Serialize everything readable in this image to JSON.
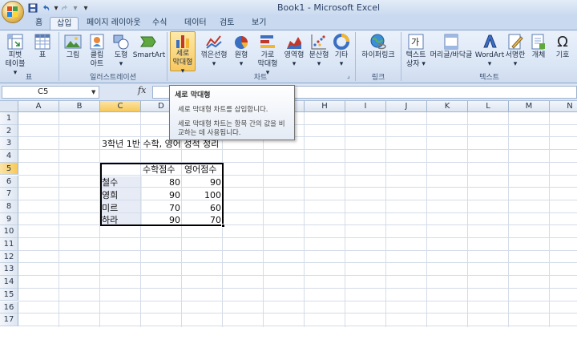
{
  "window": {
    "title": "Book1 - Microsoft Excel"
  },
  "quick_access": {
    "save": "save-icon",
    "undo": "undo-icon",
    "redo": "redo-icon",
    "customize": "▾"
  },
  "tabs": [
    {
      "label": "홈"
    },
    {
      "label": "삽입"
    },
    {
      "label": "페이지 레이아웃"
    },
    {
      "label": "수식"
    },
    {
      "label": "데이터"
    },
    {
      "label": "검토"
    },
    {
      "label": "보기"
    }
  ],
  "ribbon": {
    "groups": {
      "table": "표",
      "illustration": "일러스트레이션",
      "chart": "차트",
      "link": "링크",
      "text": "텍스트"
    },
    "buttons": {
      "pivot": "피벗\n테이블 ▾",
      "table": "표",
      "picture": "그림",
      "clipart": "클립\n아트",
      "shapes": "도형\n▾",
      "smartart": "SmartArt",
      "column": "세로\n막대형 ▾",
      "line": "꺾은선형\n▾",
      "pie": "원형\n▾",
      "bar": "가로\n막대형 ▾",
      "area": "영역형\n▾",
      "scatter": "분산형\n▾",
      "other": "기타\n▾",
      "hyperlink": "하이퍼링크",
      "textbox": "텍스트\n상자 ▾",
      "header_footer": "머리글/바닥글",
      "wordart": "WordArt\n▾",
      "signature": "서명란\n▾",
      "object": "개체",
      "symbol": "기호"
    }
  },
  "formula_bar": {
    "name_box": "C5",
    "fx": "fx",
    "value": ""
  },
  "columns": [
    "A",
    "B",
    "C",
    "D",
    "E",
    "F",
    "G",
    "H",
    "I",
    "J",
    "K",
    "L",
    "M",
    "N"
  ],
  "rows": [
    "1",
    "2",
    "3",
    "4",
    "5",
    "6",
    "7",
    "8",
    "9",
    "10",
    "11",
    "12",
    "13",
    "14",
    "15",
    "16",
    "17"
  ],
  "sheet": {
    "title": "3학년 1반 수학, 영어 성적 정리",
    "headers": [
      "수학점수",
      "영어점수"
    ],
    "records": [
      {
        "name": "철수",
        "math": "80",
        "english": "90"
      },
      {
        "name": "영희",
        "math": "90",
        "english": "100"
      },
      {
        "name": "미르",
        "math": "70",
        "english": "60"
      },
      {
        "name": "하라",
        "math": "90",
        "english": "70"
      }
    ]
  },
  "tooltip": {
    "title": "세로 막대형",
    "line1": "세로 막대형 차트를 삽입합니다.",
    "line2": "세로 막대형 차트는 항목 간의 값을 비교하는 데 사용됩니다."
  },
  "colors": {
    "ribbon": "#dce7f6",
    "selection_header": "#f7c95a",
    "accent": "#1e395b"
  }
}
